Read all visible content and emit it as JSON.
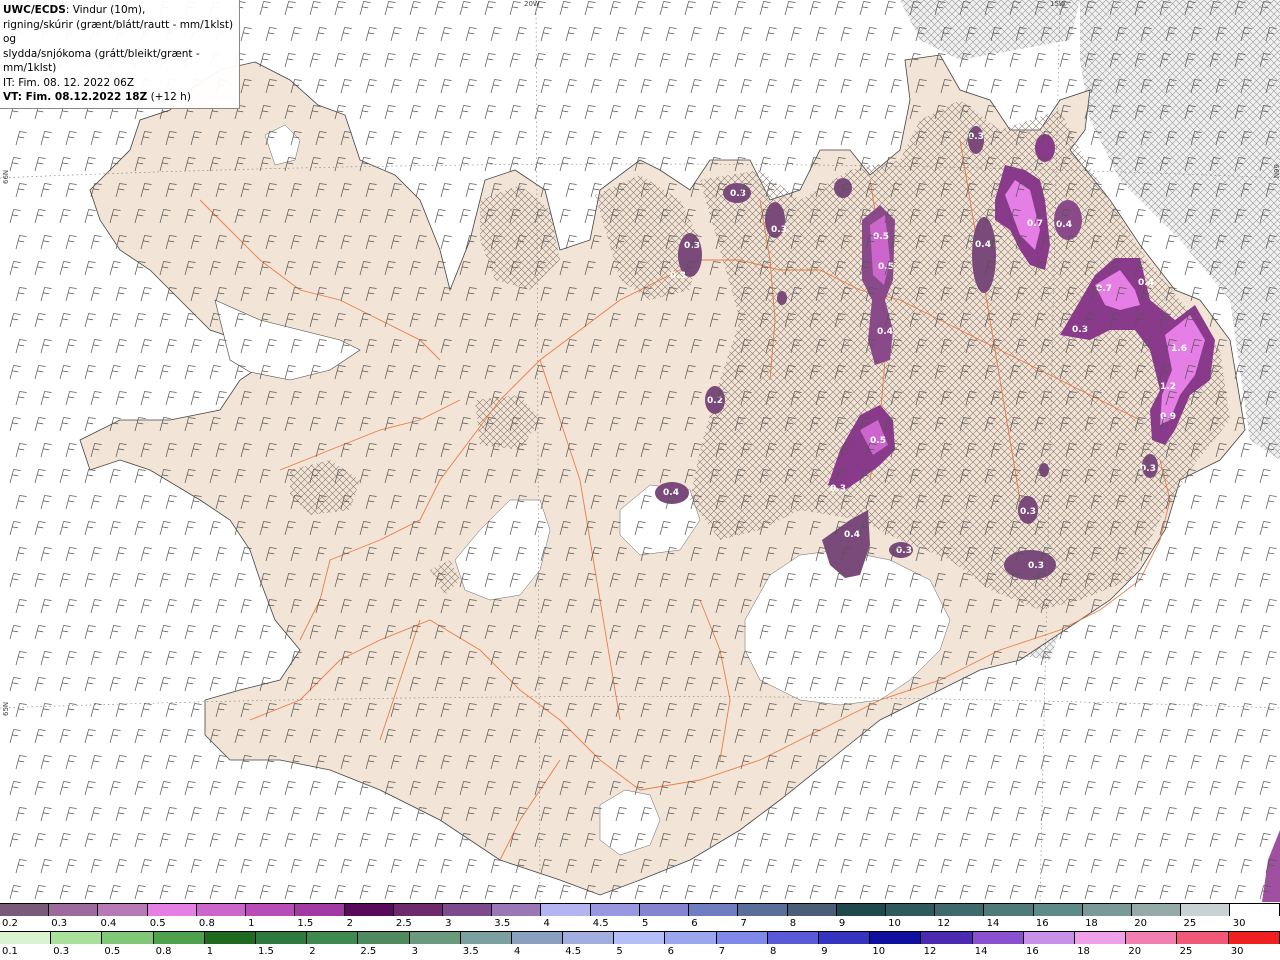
{
  "info": {
    "line1_bold": "UWC/ECDS",
    "line1_rest": ": Vindur (10m),",
    "line2": "rigning/skúrir (grænt/blátt/rautt - mm/1klst) og",
    "line3": "slydda/snjókoma (grátt/bleikt/grænt - mm/1klst)",
    "line4": "IT: Fim. 08. 12. 2022 06Z",
    "line5_bold": "VT: Fim. 08.12.2022 18Z",
    "line5_rest": " (+12 h)"
  },
  "graticule": {
    "lon_20w": "20W",
    "lon_15w": "15W",
    "lat_66n_left": "66N",
    "lat_66n_right": "66N",
    "lat_65n_left": "65N"
  },
  "precip_values": [
    {
      "label": "0.3",
      "id": "v1"
    },
    {
      "label": "0.3",
      "id": "v2"
    },
    {
      "label": "0.3",
      "id": "v3"
    },
    {
      "label": "0.3",
      "id": "v4"
    },
    {
      "label": "0.5",
      "id": "v5"
    },
    {
      "label": "0.5",
      "id": "v6"
    },
    {
      "label": "0.4",
      "id": "v7"
    },
    {
      "label": "0.7",
      "id": "v8"
    },
    {
      "label": "0.4",
      "id": "v9"
    },
    {
      "label": "0.4",
      "id": "v10"
    },
    {
      "label": "0.3",
      "id": "v11"
    },
    {
      "label": "0.7",
      "id": "v12"
    },
    {
      "label": "0.4",
      "id": "v13"
    },
    {
      "label": "0.3",
      "id": "v14"
    },
    {
      "label": "1.6",
      "id": "v15"
    },
    {
      "label": "1.2",
      "id": "v16"
    },
    {
      "label": "0.9",
      "id": "v17"
    },
    {
      "label": "0.3",
      "id": "v18"
    },
    {
      "label": "0.5",
      "id": "v19"
    },
    {
      "label": "0.3",
      "id": "v20"
    },
    {
      "label": "0.4",
      "id": "v21"
    },
    {
      "label": "0.4",
      "id": "v22"
    },
    {
      "label": "0.3",
      "id": "v23"
    },
    {
      "label": "0.3",
      "id": "v24"
    },
    {
      "label": "0.2",
      "id": "v25"
    },
    {
      "label": "0.3",
      "id": "v26"
    }
  ],
  "legend_snow": {
    "labels": [
      "0.2",
      "0.3",
      "0.4",
      "0.5",
      "0.8",
      "1",
      "1.5",
      "2",
      "2.5",
      "3",
      "3.5",
      "4",
      "4.5",
      "5",
      "6",
      "7",
      "8",
      "9",
      "10",
      "12",
      "14",
      "16",
      "18",
      "20",
      "25",
      "30"
    ],
    "colors": [
      "#7a5a7a",
      "#9c6a9c",
      "#b77ab7",
      "#e57fe5",
      "#cc66cc",
      "#b84db8",
      "#a33aa3",
      "#5a0a5a",
      "#6e2a6e",
      "#7e4a8e",
      "#9a78b8",
      "#b4b4f0",
      "#9898e0",
      "#8484d0",
      "#6e7ec0",
      "#5a6e9a",
      "#4a5e78",
      "#1e4a4e",
      "#2e5a5e",
      "#3e6a6e",
      "#4e7a7a",
      "#5e8a8a",
      "#7a9a9a",
      "#96aaaa",
      "#c8d2d2",
      "#ffffff"
    ]
  },
  "legend_rain": {
    "labels": [
      "0.1",
      "0.3",
      "0.5",
      "0.8",
      "1",
      "1.5",
      "2",
      "2.5",
      "3",
      "3.5",
      "4",
      "4.5",
      "5",
      "6",
      "7",
      "8",
      "9",
      "10",
      "12",
      "14",
      "16",
      "18",
      "20",
      "25",
      "30"
    ],
    "colors": [
      "#d8f5d0",
      "#a8e29a",
      "#80c878",
      "#4ea24e",
      "#1e6a1e",
      "#2e7a3e",
      "#3e8a4e",
      "#4e8a5e",
      "#6a9a7e",
      "#7aa0a0",
      "#8aa0c0",
      "#a0aee0",
      "#b4bef8",
      "#9aa6f0",
      "#8088e8",
      "#5a5ad8",
      "#3434c0",
      "#1010a0",
      "#4a2ab0",
      "#8a50d0",
      "#c890e8",
      "#f0a0e8",
      "#f080b0",
      "#f05a78",
      "#f02020"
    ]
  }
}
